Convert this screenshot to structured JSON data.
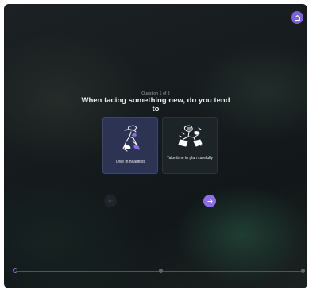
{
  "quiz": {
    "progress_label": "Question 1 of 3",
    "question": "When facing something new, do you tend to",
    "options": [
      {
        "label": "Dive in headfirst",
        "illustration": "person-diving-illustration",
        "selected": true
      },
      {
        "label": "Take time to plan carefully",
        "illustration": "person-planning-illustration",
        "selected": false
      }
    ],
    "nav": {
      "prev_icon": "arrow-left-icon",
      "next_icon": "arrow-right-icon"
    },
    "steps_total": 3,
    "current_step": 1
  },
  "header": {
    "home_icon": "home-icon"
  },
  "colors": {
    "accent": "#8d6fe3",
    "home_button": "#7b62d8",
    "selected_card": "#2d3353",
    "card": "#1c2427",
    "background": "#161b1d"
  }
}
